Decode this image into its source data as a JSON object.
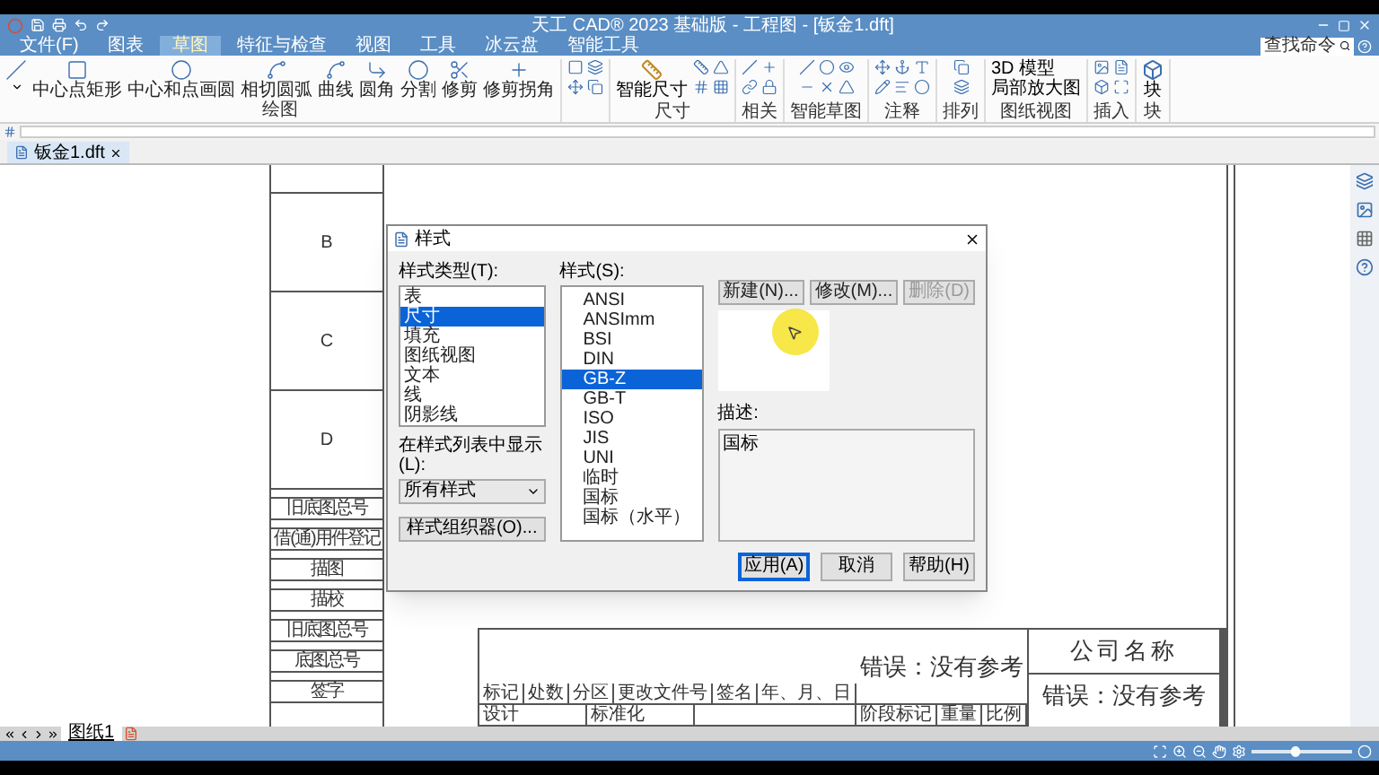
{
  "window": {
    "title": "天工 CAD® 2023 基础版 - 工程图 - [钣金1.dft]"
  },
  "menu_tabs": [
    {
      "label": "文件(F)",
      "selected": false
    },
    {
      "label": "图表",
      "selected": false
    },
    {
      "label": "草图",
      "selected": true
    },
    {
      "label": "特征与检查",
      "selected": false
    },
    {
      "label": "视图",
      "selected": false
    },
    {
      "label": "工具",
      "selected": false
    },
    {
      "label": "冰云盘",
      "selected": false
    },
    {
      "label": "智能工具",
      "selected": false
    }
  ],
  "search": {
    "placeholder": "查找命令"
  },
  "ribbon": {
    "draw_tools": [
      {
        "kind": "line"
      },
      {
        "kind": "rect",
        "label": "中心点矩形"
      },
      {
        "kind": "circle",
        "label": "中心和点画圆"
      },
      {
        "kind": "arc",
        "label": "相切圆弧"
      },
      {
        "kind": "curve",
        "label": "曲线"
      },
      {
        "kind": "fillet",
        "label": "圆角"
      },
      {
        "kind": "split",
        "label": "分割"
      },
      {
        "kind": "trim",
        "label": "修剪"
      },
      {
        "kind": "cross",
        "label": "修剪拐角"
      }
    ],
    "smart_dimension": "智能尺寸",
    "view_tools": [
      "3D 模型",
      "局部放大图"
    ],
    "block_button": "块",
    "group_labels": [
      "绘图",
      "尺寸",
      "相关",
      "智能草图",
      "注释",
      "排列",
      "图纸视图",
      "插入",
      "块"
    ]
  },
  "document_tab": {
    "label": "钣金1.dft"
  },
  "drawing": {
    "zones": [
      "B",
      "C",
      "D"
    ],
    "side_labels": [
      "旧底图总号",
      "借(通)用件登记",
      "描图",
      "描校",
      "旧底图总号",
      "底图总号",
      "签字"
    ],
    "title_block": {
      "change_labels": [
        "标记",
        "处数",
        "分区",
        "更改文件号",
        "签名",
        "年、月、日"
      ],
      "role_labels": [
        "设计",
        "标准化"
      ],
      "drawing_name": "错误：没有参考",
      "stage_labels": [
        "阶段标记",
        "重量",
        "比例"
      ],
      "company": "公司名称",
      "drawing_number": "错误：没有参考"
    }
  },
  "dialog": {
    "title": "样式",
    "type_label": "样式类型(T):",
    "types": [
      {
        "label": "表",
        "selected": false
      },
      {
        "label": "尺寸",
        "selected": true
      },
      {
        "label": "填充",
        "selected": false
      },
      {
        "label": "图纸视图",
        "selected": false
      },
      {
        "label": "文本",
        "selected": false
      },
      {
        "label": "线",
        "selected": false
      },
      {
        "label": "阴影线",
        "selected": false
      }
    ],
    "show_label": "在样式列表中显示(L):",
    "show_value": "所有样式",
    "organizer_button": "样式组织器(O)...",
    "styles_label": "样式(S):",
    "styles": [
      {
        "label": "ANSI",
        "selected": false
      },
      {
        "label": "ANSImm",
        "selected": false
      },
      {
        "label": "BSI",
        "selected": false
      },
      {
        "label": "DIN",
        "selected": false
      },
      {
        "label": "GB-Z",
        "selected": true
      },
      {
        "label": "GB-T",
        "selected": false
      },
      {
        "label": "ISO",
        "selected": false
      },
      {
        "label": "JIS",
        "selected": false
      },
      {
        "label": "UNI",
        "selected": false
      },
      {
        "label": "临时",
        "selected": false
      },
      {
        "label": "国标",
        "selected": false
      },
      {
        "label": "国标（水平）",
        "selected": false
      }
    ],
    "actions": [
      {
        "label": "新建(N)...",
        "disabled": false
      },
      {
        "label": "修改(M)...",
        "disabled": false
      },
      {
        "label": "删除(D)",
        "disabled": true
      }
    ],
    "description_label": "描述:",
    "description": "国标",
    "buttons": [
      {
        "label": "应用(A)",
        "selected": true
      },
      {
        "label": "取消",
        "selected": false
      },
      {
        "label": "帮助(H)",
        "selected": false
      }
    ]
  },
  "sheet_tabs": [
    {
      "label": "图纸1",
      "selected": true
    }
  ],
  "zoom": {
    "level": 0.42
  }
}
